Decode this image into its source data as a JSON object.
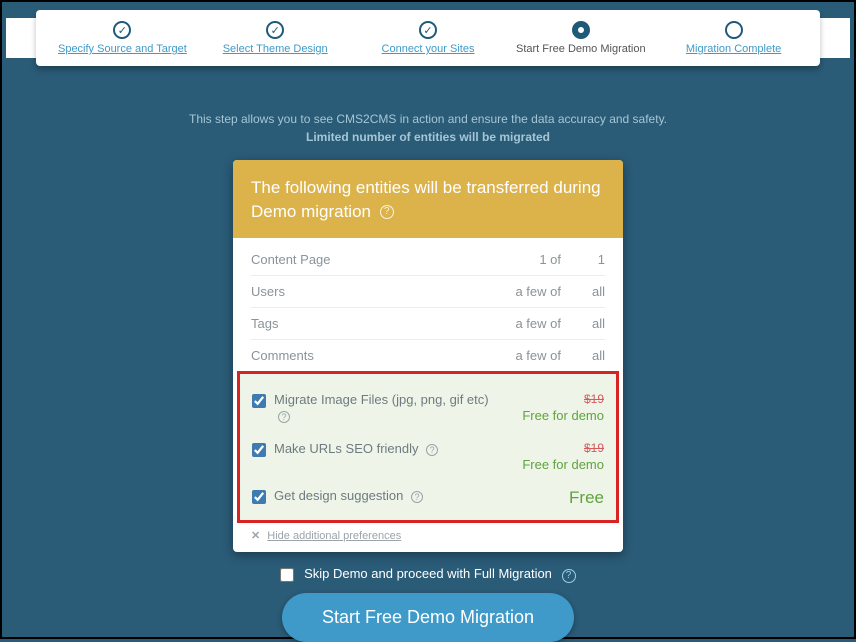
{
  "steps": [
    {
      "label": "Specify Source and Target",
      "state": "done"
    },
    {
      "label": "Select Theme Design",
      "state": "done"
    },
    {
      "label": "Connect your Sites",
      "state": "done"
    },
    {
      "label": "Start Free Demo Migration",
      "state": "active"
    },
    {
      "label": "Migration Complete",
      "state": "pending"
    }
  ],
  "intro": {
    "line1": "This step allows you to see CMS2CMS in action and ensure the data accuracy and safety.",
    "line2": "Limited number of entities will be migrated"
  },
  "panel": {
    "title": "The following entities will be transferred during Demo migration"
  },
  "entities": [
    {
      "name": "Content Page",
      "count": "1 of",
      "total": "1"
    },
    {
      "name": "Users",
      "count": "a few of",
      "total": "all"
    },
    {
      "name": "Tags",
      "count": "a few of",
      "total": "all"
    },
    {
      "name": "Comments",
      "count": "a few of",
      "total": "all"
    }
  ],
  "options": [
    {
      "checked": true,
      "label": "Migrate Image Files (jpg, png, gif etc)",
      "strike": "$19",
      "price": "Free for demo",
      "big": false
    },
    {
      "checked": true,
      "label": "Make URLs SEO friendly",
      "strike": "$19",
      "price": "Free for demo",
      "big": false
    },
    {
      "checked": true,
      "label": "Get design suggestion",
      "strike": "",
      "price": "Free",
      "big": true
    }
  ],
  "hidePref": "Hide additional preferences",
  "skip": {
    "label": "Skip Demo and proceed with Full Migration"
  },
  "cta": "Start Free Demo Migration"
}
